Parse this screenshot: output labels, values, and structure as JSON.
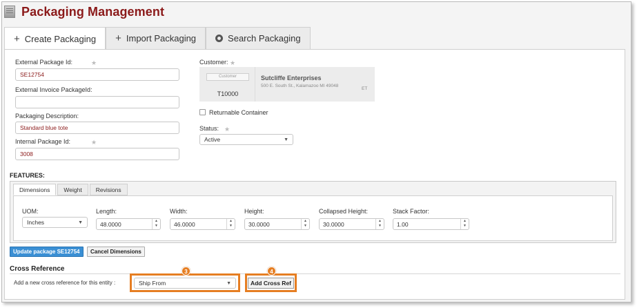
{
  "app": {
    "title": "Packaging Management"
  },
  "tabs": [
    {
      "icon": "plus-icon",
      "label": "Create Packaging"
    },
    {
      "icon": "plus-icon",
      "label": "Import Packaging"
    },
    {
      "icon": "gear-icon",
      "label": "Search Packaging"
    }
  ],
  "form": {
    "external_package_id": {
      "label": "External Package Id:",
      "value": "SE12754",
      "required": true
    },
    "external_invoice_package_id": {
      "label": "External Invoice PackageId:",
      "value": ""
    },
    "packaging_description": {
      "label": "Packaging Description:",
      "value": "Standard blue tote"
    },
    "internal_package_id": {
      "label": "Internal Package Id:",
      "value": "3008",
      "required": true
    },
    "customer": {
      "label": "Customer:",
      "tag": "Customer",
      "code": "T10000",
      "name": "Sutcliffe Enterprises",
      "address": "500 E. South St., Kalamazoo MI 49048",
      "timezone": "ET"
    },
    "returnable_container": {
      "label": "Returnable Container",
      "checked": false
    },
    "status": {
      "label": "Status:",
      "value": "Active"
    }
  },
  "features": {
    "title": "FEATURES:",
    "tabs": [
      "Dimensions",
      "Weight",
      "Revisions"
    ],
    "active_tab": "Dimensions",
    "uom": {
      "label": "UOM:",
      "value": "Inches"
    },
    "length": {
      "label": "Length:",
      "value": "48.0000"
    },
    "width": {
      "label": "Width:",
      "value": "46.0000"
    },
    "height": {
      "label": "Height:",
      "value": "30.0000"
    },
    "collapsed_height": {
      "label": "Collapsed Height:",
      "value": "30.0000"
    },
    "stack_factor": {
      "label": "Stack Factor:",
      "value": "1.00"
    }
  },
  "actions": {
    "update_label": "Update package SE12754",
    "cancel_label": "Cancel Dimensions"
  },
  "cross_reference": {
    "title": "Cross Reference",
    "prompt": "Add a new cross reference for this entity :",
    "type_value": "Ship From",
    "add_label": "Add Cross Ref",
    "callout_type": "3",
    "callout_add": "4"
  },
  "colors": {
    "title": "#8b1a1a",
    "primary_button": "#3a8fd4",
    "callout": "#e67e22"
  }
}
